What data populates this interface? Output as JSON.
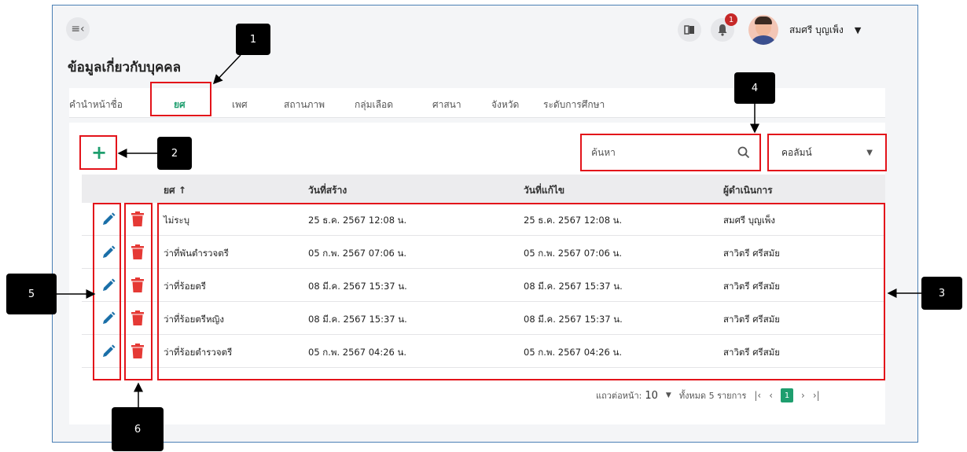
{
  "page": {
    "title": "ข้อมูลเกี่ยวกับบุคคล"
  },
  "header": {
    "notification_count": "1",
    "user_name": "สมศรี บุญเพ็ง"
  },
  "tabs": [
    {
      "label": "คำนำหน้าชื่อ"
    },
    {
      "label": "ยศ",
      "active": true
    },
    {
      "label": "เพศ"
    },
    {
      "label": "สถานภาพ"
    },
    {
      "label": "กลุ่มเลือด"
    },
    {
      "label": "ศาสนา"
    },
    {
      "label": "จังหวัด"
    },
    {
      "label": "ระดับการศึกษา"
    }
  ],
  "toolbar": {
    "add_label": "+",
    "search_placeholder": "ค้นหา",
    "column_select_value": "คอลัมน์"
  },
  "table": {
    "headers": {
      "rank": "ยศ ↑",
      "created": "วันที่สร้าง",
      "modified": "วันที่แก้ไข",
      "operator": "ผู้ดำเนินการ"
    },
    "rows": [
      {
        "rank": "ไม่ระบุ",
        "created": "25 ธ.ค. 2567 12:08 น.",
        "modified": "25 ธ.ค. 2567 12:08 น.",
        "operator": "สมศรี บุญเพ็ง"
      },
      {
        "rank": "ว่าที่พันตำรวจตรี",
        "created": "05 ก.พ. 2567 07:06 น.",
        "modified": "05 ก.พ. 2567 07:06 น.",
        "operator": "สาวิตรี ศรีสมัย"
      },
      {
        "rank": "ว่าที่ร้อยตรี",
        "created": "08 มี.ค. 2567 15:37 น.",
        "modified": "08 มี.ค. 2567 15:37 น.",
        "operator": "สาวิตรี ศรีสมัย"
      },
      {
        "rank": "ว่าที่ร้อยตรีหญิง",
        "created": "08 มี.ค. 2567 15:37 น.",
        "modified": "08 มี.ค. 2567 15:37 น.",
        "operator": "สาวิตรี ศรีสมัย"
      },
      {
        "rank": "ว่าที่ร้อยตำรวจตรี",
        "created": "05 ก.พ. 2567 04:26 น.",
        "modified": "05 ก.พ. 2567 04:26 น.",
        "operator": "สาวิตรี ศรีสมัย"
      }
    ]
  },
  "pagination": {
    "rows_per_page_label": "แถวต่อหน้า:",
    "rows_per_page_value": "10",
    "total_label": "ทั้งหมด 5 รายการ",
    "current_page": "1"
  },
  "annotations": [
    {
      "label": "1"
    },
    {
      "label": "2"
    },
    {
      "label": "3"
    },
    {
      "label": "4"
    },
    {
      "label": "5"
    },
    {
      "label": "6"
    }
  ],
  "colors": {
    "accent": "#1e9e6e",
    "edit_icon": "#1a6fa8",
    "delete_icon": "#e53935",
    "annotation_box": "#e3131a",
    "badge": "#c62828"
  }
}
